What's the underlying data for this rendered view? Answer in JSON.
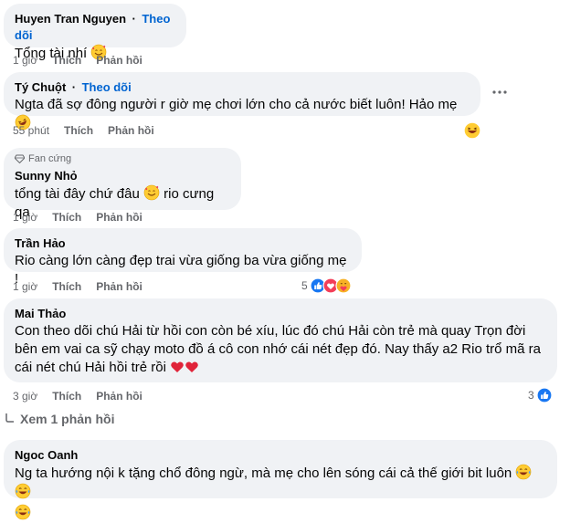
{
  "comments": [
    {
      "author": "Huyen Tran Nguyen",
      "follow": "Theo dõi",
      "text": "Tổng tài nhí",
      "time": "1 giờ",
      "like": "Thích",
      "reply": "Phản hồi"
    },
    {
      "author": "Tý Chuột",
      "follow": "Theo dõi",
      "text": "Ngta đã sợ đông người r giờ mẹ chơi lớn cho cả nước biết luôn! Hảo mẹ",
      "time": "55 phút",
      "like": "Thích",
      "reply": "Phản hồi"
    },
    {
      "badge": "Fan cứng",
      "author": "Sunny Nhỏ",
      "text_a": "tổng tài đây chứ đâu",
      "text_b": "rio cưng qa",
      "time": "1 giờ",
      "like": "Thích",
      "reply": "Phản hồi"
    },
    {
      "author": "Trần Hảo",
      "text": "Rio càng lớn càng đẹp trai vừa giống ba vừa giống mẹ !",
      "time": "1 giờ",
      "like": "Thích",
      "reply": "Phản hồi",
      "reactions": "5"
    },
    {
      "author": "Mai Thảo",
      "line1": "Con theo dõi chú Hải từ hồi con còn bé xíu, lúc đó chú Hải còn trẻ mà quay Trọn đời",
      "line2": "bên em vai ca sỹ chạy moto đồ á cô con nhớ cái nét đẹp đó. Nay thấy a2 Rio trổ mã ra",
      "line3": "cái nét chú Hải hồi trẻ rồi",
      "time": "3 giờ",
      "like": "Thích",
      "reply": "Phản hồi",
      "reactions": "3"
    },
    {
      "author": "Ngoc Oanh",
      "text": "Ng ta hướng nội k tặng chổ đông ngừ, mà mẹ cho lên sóng cái cả thế giới bit luôn"
    }
  ],
  "view_replies": "Xem 1 phản hồi",
  "colors": {
    "bubble": "#f0f2f5",
    "link": "#0064d1",
    "muted": "#65676b",
    "like_blue": "#1877f2"
  }
}
